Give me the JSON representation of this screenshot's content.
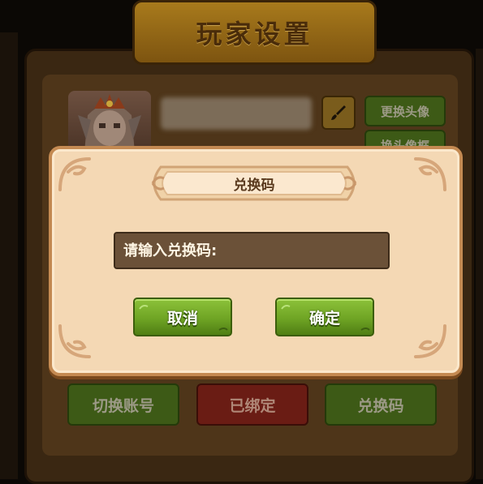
{
  "screen": {
    "title": "玩家设置"
  },
  "profile": {
    "change_avatar_label": "更换头像",
    "change_frame_label": "换头像框"
  },
  "footer_buttons": {
    "switch_account": "切换账号",
    "bound": "已绑定",
    "redeem_code": "兑换码"
  },
  "dialog": {
    "title": "兑换码",
    "input_placeholder": "请输入兑换码:",
    "cancel_label": "取消",
    "confirm_label": "确定"
  },
  "colors": {
    "dialog_bg": "#f4d8b4",
    "dialog_border": "#c48a52",
    "button_green": "#6fa424",
    "input_bg": "#6b5138",
    "bound_red": "#6a1c14"
  },
  "icons": {
    "edit": "brush-icon",
    "avatar": "player-avatar"
  }
}
